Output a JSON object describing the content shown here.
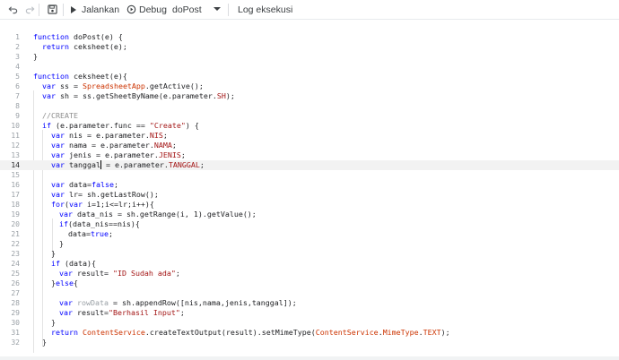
{
  "toolbar": {
    "run_label": "Jalankan",
    "debug_label": "Debug",
    "function_selected": "doPost",
    "log_label": "Log eksekusi"
  },
  "icons": {
    "undo": "undo-icon",
    "redo": "redo-icon",
    "save": "save-icon",
    "run": "play-icon",
    "debug": "debug-icon",
    "dropdown": "caret-down-icon"
  },
  "editor": {
    "active_line": 14,
    "line_numbers": [
      "1",
      "2",
      "3",
      "4",
      "5",
      "6",
      "7",
      "8",
      "9",
      "10",
      "11",
      "12",
      "13",
      "14",
      "15",
      "16",
      "17",
      "18",
      "19",
      "20",
      "21",
      "22",
      "23",
      "24",
      "25",
      "26",
      "27",
      "28",
      "29",
      "30",
      "31",
      "32"
    ]
  },
  "code": {
    "l1": {
      "kw": "function",
      "rest": " doPost(e) {"
    },
    "l2": {
      "kw": "return",
      "rest": " ceksheet(e);"
    },
    "l3": {
      "rest": "}"
    },
    "l5": {
      "kw": "function",
      "rest": " ceksheet(e){"
    },
    "l6": {
      "kw": "var",
      "a": " ss = ",
      "svc": "SpreadsheetApp",
      "b": ".getActive();"
    },
    "l7": {
      "kw": "var",
      "a": " sh = ss.getSheetByName(e.parameter.",
      "prop": "SH",
      "b": ");"
    },
    "l9": {
      "cm": "//CREATE"
    },
    "l10": {
      "kw": "if",
      "a": " (e.parameter.func == ",
      "str": "\"Create\"",
      "b": ") {"
    },
    "l11": {
      "kw": "var",
      "a": " nis = e.parameter.",
      "prop": "NIS",
      "b": ";"
    },
    "l12": {
      "kw": "var",
      "a": " nama = e.parameter.",
      "prop": "NAMA",
      "b": ";"
    },
    "l13": {
      "kw": "var",
      "a": " jenis = e.parameter.",
      "prop": "JENIS",
      "b": ";"
    },
    "l14": {
      "kw": "var",
      "a": " tanggal",
      "c": " = e.parameter.",
      "prop": "TANGGAL",
      "b": ";"
    },
    "l16": {
      "kw": "var",
      "a": " data=",
      "kw2": "false",
      "b": ";"
    },
    "l17": {
      "kw": "var",
      "a": " lr= sh.getLastRow();"
    },
    "l18": {
      "kw": "for",
      "a": "(",
      "kw2": "var",
      "b": " i=1;i<=lr;i++){"
    },
    "l19": {
      "kw": "var",
      "a": " data_nis = sh.getRange(i, 1).getValue();"
    },
    "l20": {
      "kw": "if",
      "a": "(data_nis==nis){"
    },
    "l21": {
      "a": "data=",
      "kw2": "true",
      "b": ";"
    },
    "l22": {
      "rest": "}"
    },
    "l23": {
      "rest": "}"
    },
    "l24": {
      "kw": "if",
      "a": " (data){"
    },
    "l25": {
      "kw": "var",
      "a": " result= ",
      "str": "\"ID Sudah ada\"",
      "b": ";"
    },
    "l26": {
      "a": "}",
      "kw": "else",
      "b": "{"
    },
    "l28": {
      "kw": "var",
      "faint": " rowData",
      "a": " = sh.appendRow([nis,nama,jenis,tanggal]);"
    },
    "l29": {
      "kw": "var",
      "a": " result=",
      "str": "\"Berhasil Input\"",
      "b": ";"
    },
    "l30": {
      "rest": "}"
    },
    "l31": {
      "kw": "return",
      "a": " ",
      "svc": "ContentService",
      "b": ".createTextOutput(result).setMimeType(",
      "svc2": "ContentService",
      "c": ".",
      "svc3": "MimeType",
      "d": ".",
      "svc4": "TEXT",
      "e": ");"
    },
    "l32": {
      "rest": "}"
    }
  }
}
